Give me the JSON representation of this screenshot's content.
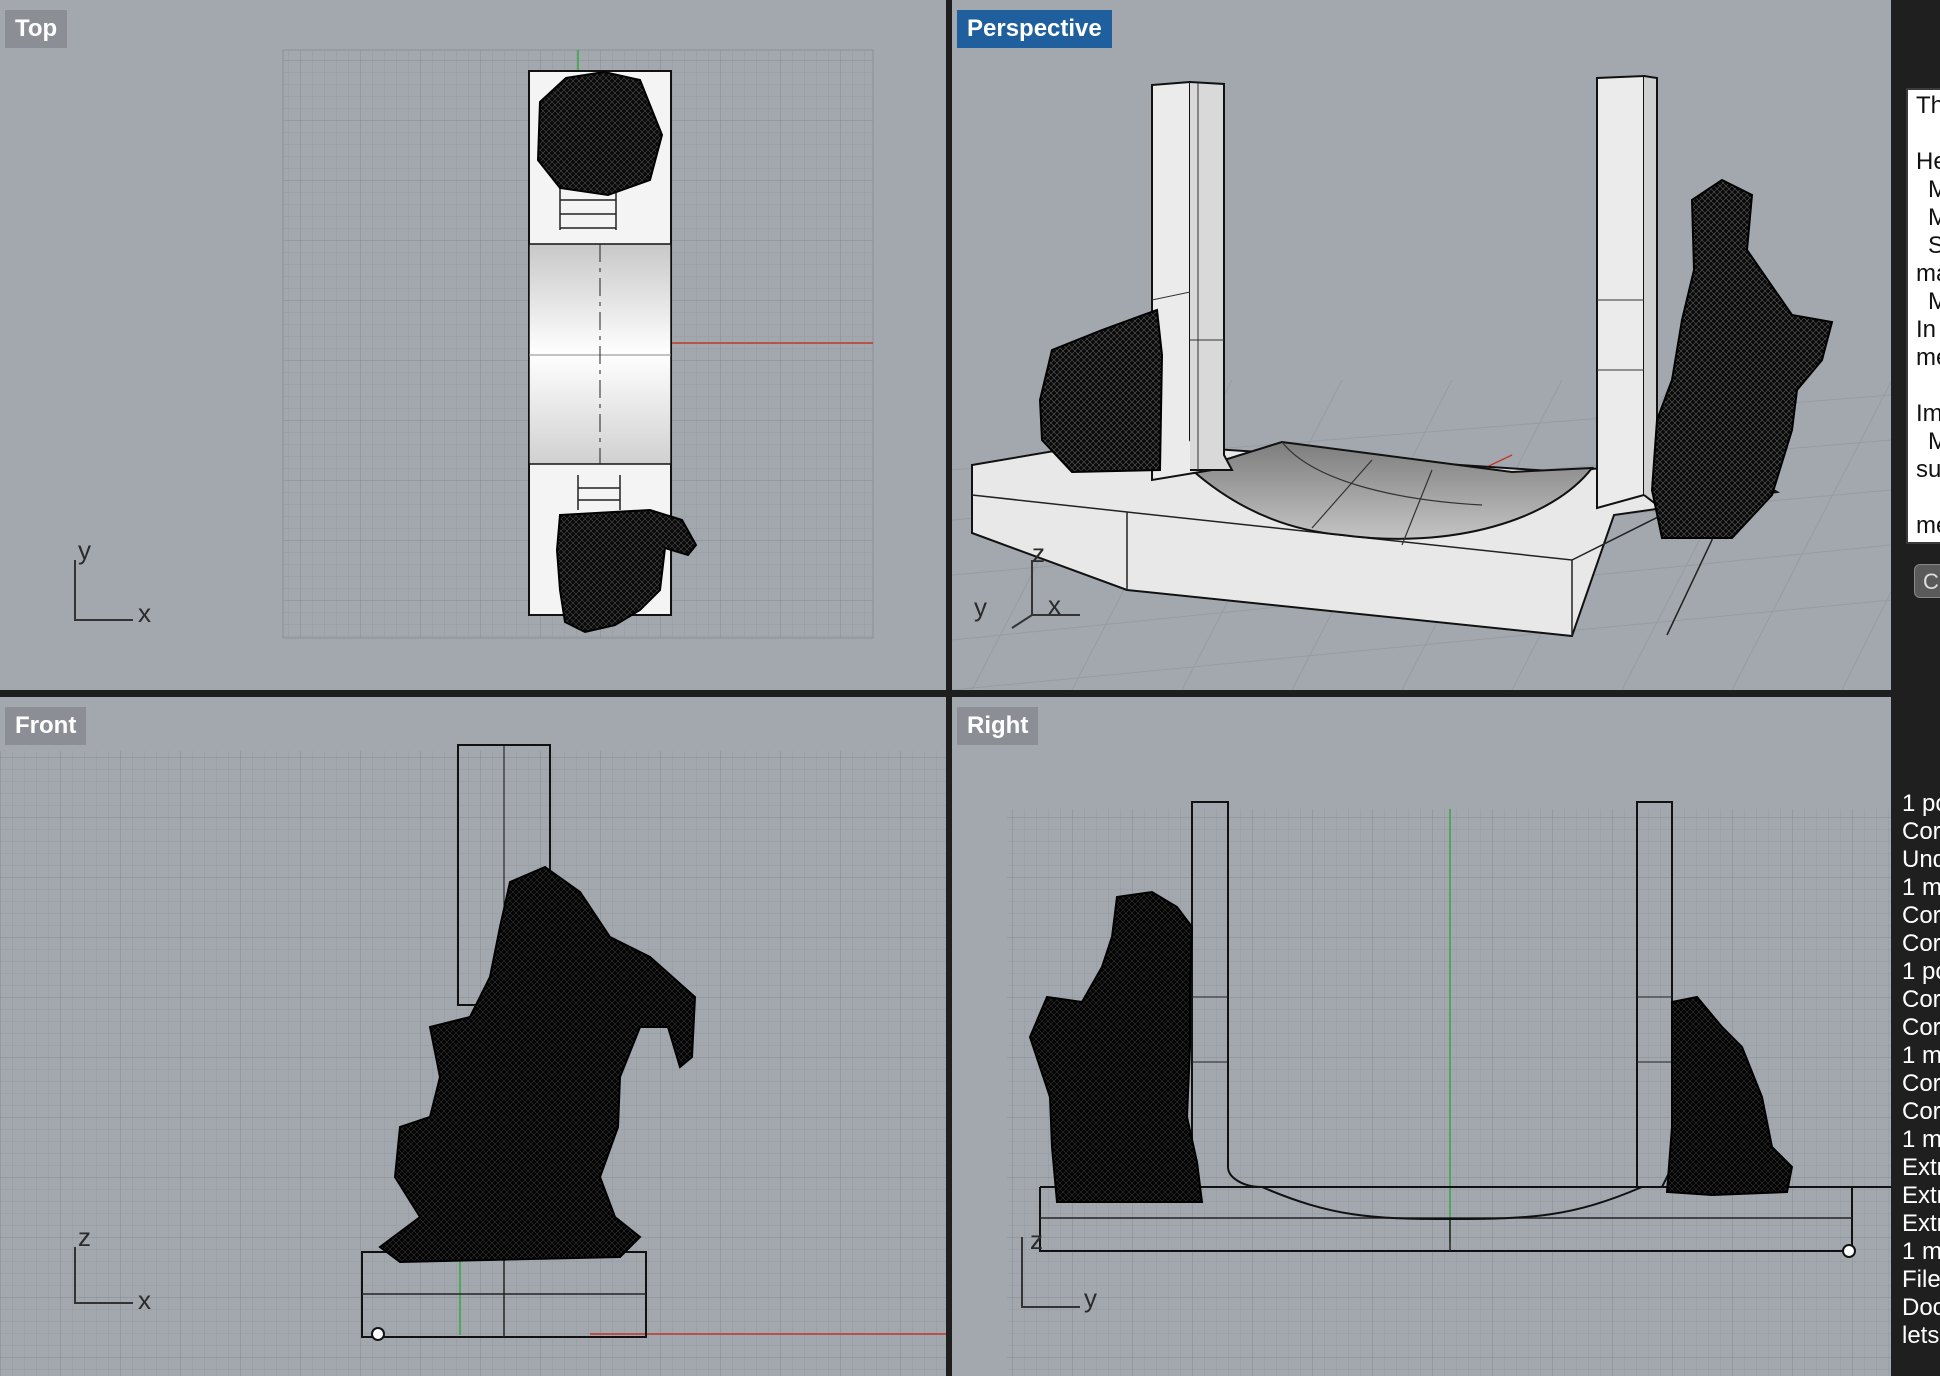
{
  "viewports": {
    "top": {
      "label": "Top",
      "axes": [
        "y",
        "x"
      ]
    },
    "perspective": {
      "label": "Perspective",
      "axes": [
        "z",
        "y",
        "x"
      ]
    },
    "front": {
      "label": "Front",
      "axes": [
        "z",
        "x"
      ]
    },
    "right": {
      "label": "Right",
      "axes": [
        "z",
        "y"
      ]
    }
  },
  "help_panel": {
    "lines": [
      "Th",
      "He",
      "M",
      "M",
      "S",
      "ma",
      "M",
      "In",
      "me",
      "Im",
      "M",
      "su",
      "me"
    ]
  },
  "help_button": "C",
  "command_history": [
    "1 po",
    "Cor",
    "Und",
    "1 m",
    "Cor",
    "Cor",
    "1 po",
    "Cor",
    "Cor",
    "1 m",
    "Cor",
    "Cor",
    "1 m",
    "Extr",
    "Extr",
    "Extr",
    "1 m",
    "File",
    "Doc",
    "lets"
  ],
  "colors": {
    "viewport_bg": "#a3a8ae",
    "active_label": "#1f5f9e",
    "inactive_label": "#8b8f95",
    "x_axis": "#c0392b",
    "y_axis": "#2eaa3f"
  }
}
